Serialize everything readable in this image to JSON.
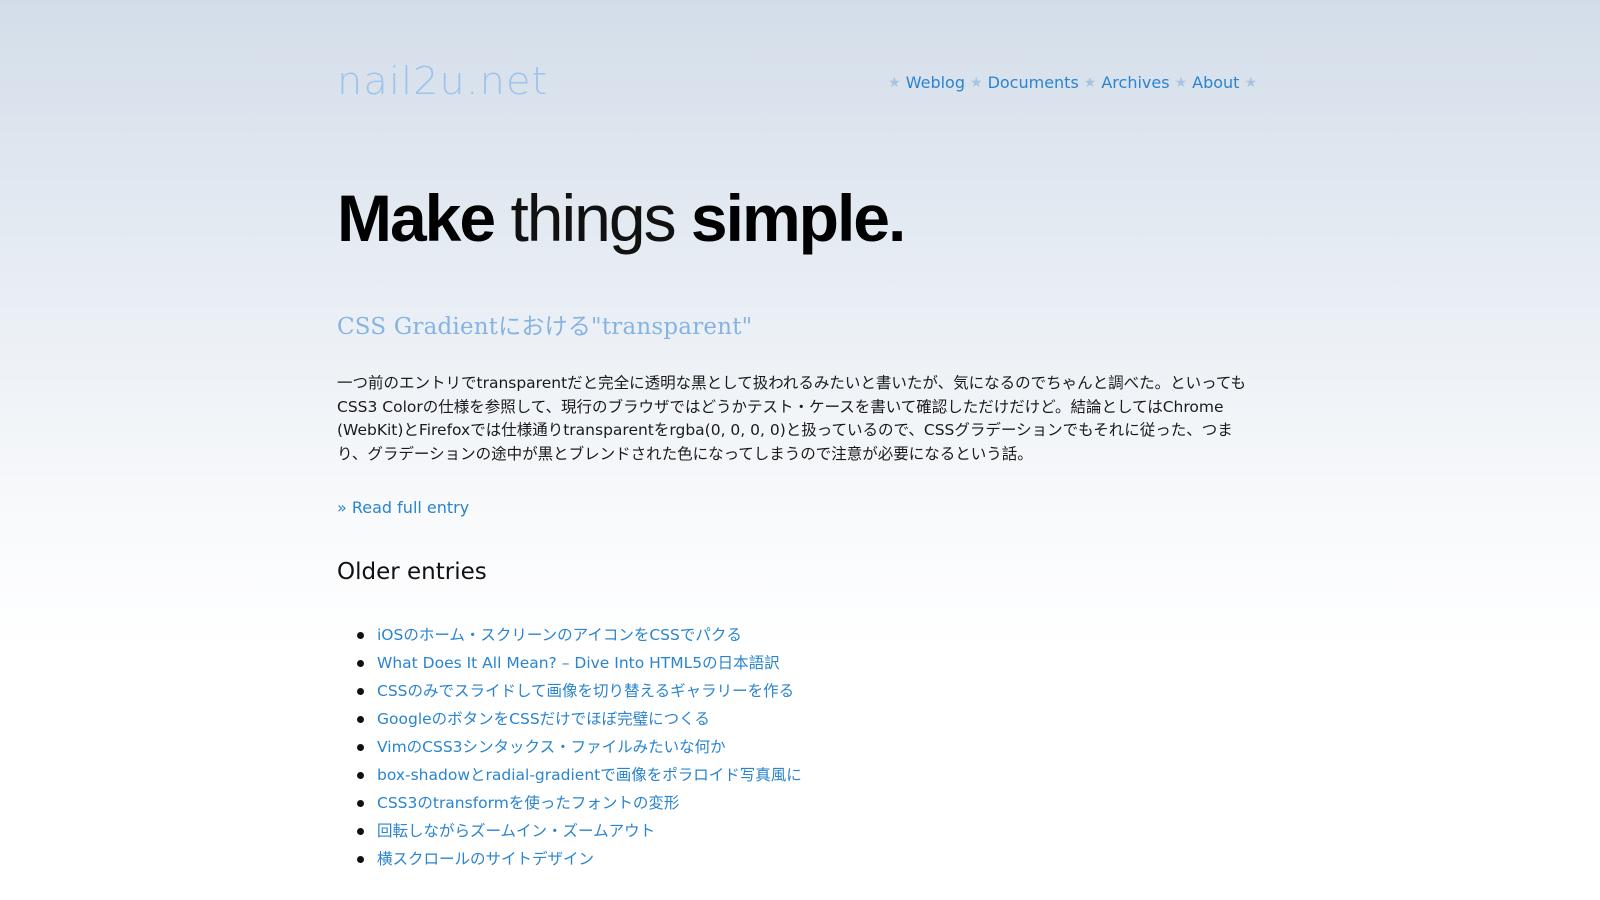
{
  "header": {
    "logo_text": "nail2u.net",
    "nav": [
      {
        "label": "Weblog"
      },
      {
        "label": "Documents"
      },
      {
        "label": "Archives"
      },
      {
        "label": "About"
      }
    ],
    "nav_separator": "★"
  },
  "tagline": {
    "part1": "Make",
    "part2": " things ",
    "part3": "simple."
  },
  "entry": {
    "title": "CSS Gradientにおける\"transparent\"",
    "body": "一つ前のエントリでtransparentだと完全に透明な黒として扱われるみたいと書いたが、気になるのでちゃんと調べた。といってもCSS3 Colorの仕様を参照して、現行のブラウザではどうかテスト・ケースを書いて確認しただけだけど。結論としてはChrome (WebKit)とFirefoxでは仕様通りtransparentをrgba(0, 0, 0, 0)と扱っているので、CSSグラデーションでもそれに従った、つまり、グラデーションの途中が黒とブレンドされた色になってしまうので注意が必要になるという話。",
    "read_more": "» Read full entry"
  },
  "older": {
    "heading": "Older entries",
    "items": [
      {
        "label": "iOSのホーム・スクリーンのアイコンをCSSでパクる"
      },
      {
        "label": "What Does It All Mean? – Dive Into HTML5の日本語訳"
      },
      {
        "label": "CSSのみでスライドして画像を切り替えるギャラリーを作る"
      },
      {
        "label": "GoogleのボタンをCSSだけでほぼ完璧につくる"
      },
      {
        "label": "VimのCSS3シンタックス・ファイルみたいな何か"
      },
      {
        "label": "box-shadowとradial-gradientで画像をポラロイド写真風に"
      },
      {
        "label": "CSS3のtransformを使ったフォントの変形"
      },
      {
        "label": "回転しながらズームイン・ズームアウト"
      },
      {
        "label": "横スクロールのサイトデザイン"
      }
    ]
  },
  "colors": {
    "link": "#2a84cf",
    "logo": "#9ec4ec",
    "entry_title": "#87b3e3",
    "nav_star": "#a7c3e1"
  }
}
